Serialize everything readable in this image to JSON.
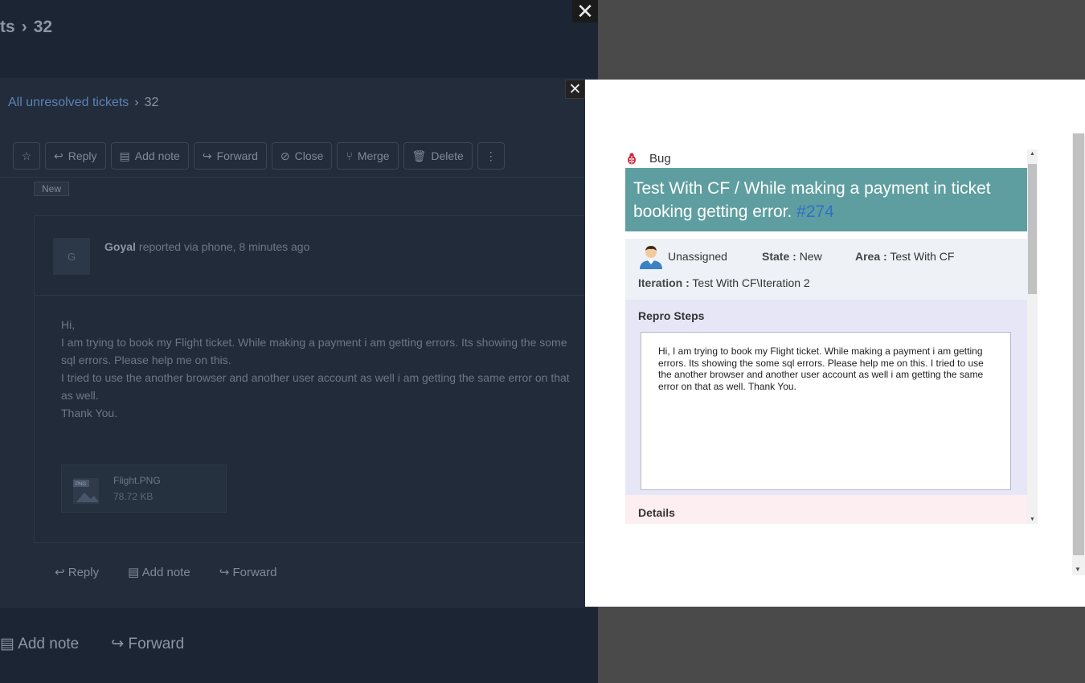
{
  "background": {
    "top_breadcrumb": {
      "parent": "ts",
      "current": "32"
    },
    "inner_breadcrumb": {
      "parent": "All unresolved tickets",
      "current": "32"
    },
    "toolbar": {
      "reply": "Reply",
      "add_note": "Add note",
      "forward": "Forward",
      "close": "Close",
      "merge": "Merge",
      "delete": "Delete"
    },
    "status_badge": "New",
    "conversation": {
      "avatar_initial": "G",
      "reporter_name": "Goyal",
      "reporter_meta": "reported via phone, 8 minutes ago",
      "lines": [
        "Hi,",
        "I am trying to book my Flight ticket. While making a payment i am getting errors. Its showing the some sql errors. Please help me on this.",
        "I tried to use the another browser and another user account as well i am getting the same error on that as well.",
        "Thank You."
      ],
      "attachment": {
        "name": "Flight.PNG",
        "size": "78.72 KB"
      }
    },
    "bottom_actions": {
      "reply": "Reply",
      "add_note": "Add note",
      "forward": "Forward"
    },
    "footer_actions": {
      "add_note": "Add note",
      "forward": "Forward"
    }
  },
  "modal": {
    "work_item": {
      "type": "Bug",
      "title": "Test With CF / While making a payment in ticket booking getting error.",
      "id": "#274",
      "assignee": "Unassigned",
      "state_label": "State :",
      "state_value": "New",
      "area_label": "Area :",
      "area_value": "Test With CF",
      "iteration_label": "Iteration :",
      "iteration_value": "Test With CF\\Iteration 2",
      "repro_title": "Repro Steps",
      "repro_text": "Hi, I am trying to book my Flight ticket. While making a payment i am getting errors. Its showing the some sql errors. Please help me on this. I tried to use the another browser and another user account as well i am getting the same error on that as well. Thank You.",
      "details_title": "Details"
    }
  },
  "colors": {
    "title_bar": "#5f9ea0",
    "work_item_id": "#2e6fc9",
    "meta_bg": "#eef2f6",
    "repro_bg": "#e6e6f7",
    "details_bg": "#fdeef2",
    "overlay": "#4a4a4a"
  },
  "icons": {
    "bug": "bug-icon",
    "assignee": "person-avatar-icon",
    "close": "close-icon"
  }
}
